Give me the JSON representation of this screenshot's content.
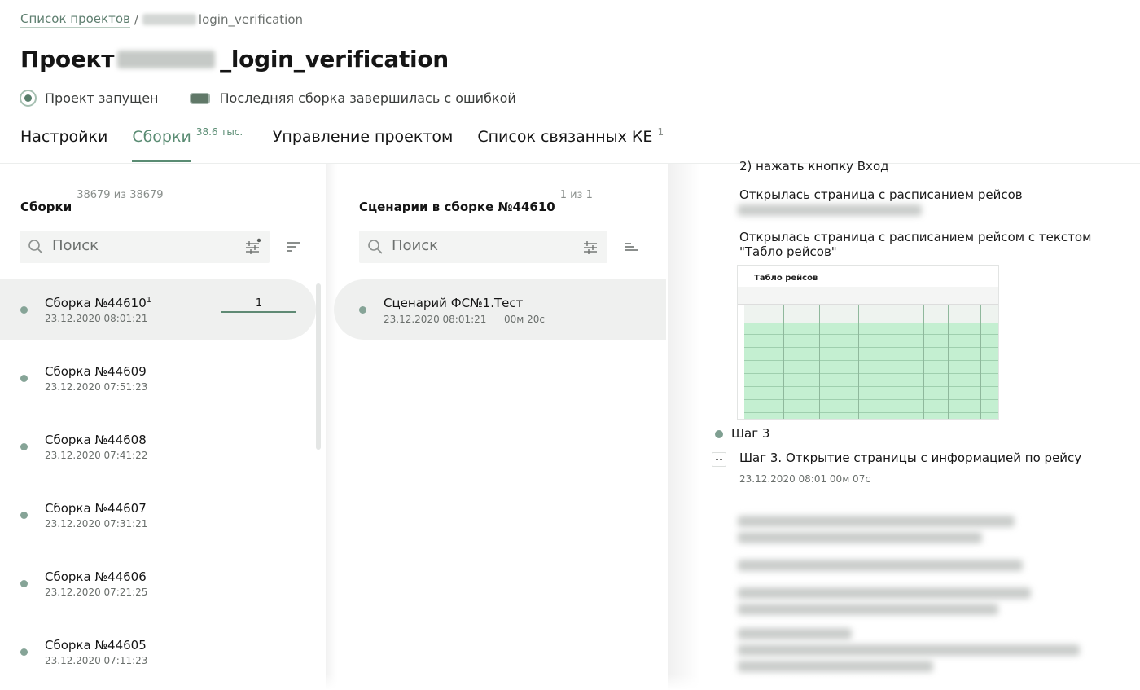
{
  "breadcrumb": {
    "root": "Список проектов",
    "separator": "/",
    "current_suffix": "login_verification"
  },
  "header": {
    "title_prefix": "Проект",
    "title_suffix": "_login_verification",
    "status_running": "Проект запущен",
    "status_last_build": "Последняя сборка завершилась с ошибкой"
  },
  "tabs": [
    {
      "label": "Настройки",
      "badge": ""
    },
    {
      "label": "Сборки",
      "badge": "38.6 тыс."
    },
    {
      "label": "Управление проектом",
      "badge": ""
    },
    {
      "label": "Список связанных КЕ",
      "badge": "1"
    }
  ],
  "builds": {
    "title": "Сборки",
    "count": "38679 из 38679",
    "search_placeholder": "Поиск",
    "items": [
      {
        "title": "Сборка №44610",
        "sup": "1",
        "date": "23.12.2020 08:01:21",
        "progress": "1"
      },
      {
        "title": "Сборка №44609",
        "sup": "",
        "date": "23.12.2020 07:51:23",
        "progress": ""
      },
      {
        "title": "Сборка №44608",
        "sup": "",
        "date": "23.12.2020 07:41:22",
        "progress": ""
      },
      {
        "title": "Сборка №44607",
        "sup": "",
        "date": "23.12.2020 07:31:21",
        "progress": ""
      },
      {
        "title": "Сборка №44606",
        "sup": "",
        "date": "23.12.2020 07:21:25",
        "progress": ""
      },
      {
        "title": "Сборка №44605",
        "sup": "",
        "date": "23.12.2020 07:11:23",
        "progress": ""
      }
    ]
  },
  "scenarios": {
    "title": "Сценарии в сборке №44610",
    "count": "1 из 1",
    "search_placeholder": "Поиск",
    "items": [
      {
        "title": "Сценарий ФС№1.Тест",
        "date": "23.12.2020 08:01:21",
        "duration": "00м 20с"
      }
    ]
  },
  "steps": {
    "line_1": "2) нажать кнопку Вход",
    "line_2": "Открылась страница с расписанием рейсов",
    "line_3a": "Открылась страница с расписанием рейсом с текстом",
    "line_3b": "\"Табло рейсов\"",
    "screenshot_title": "Табло рейсов",
    "step_label": "Шаг 3",
    "step_head": "Шаг 3. Открытие страницы с информацией по рейсу",
    "step_meta": "23.12.2020 08:01 00м 07с"
  },
  "colors": {
    "accent": "#5a8c73",
    "dot": "#86a497",
    "selected_bg": "#eff0ef",
    "grid_green": "#c4efd1"
  }
}
